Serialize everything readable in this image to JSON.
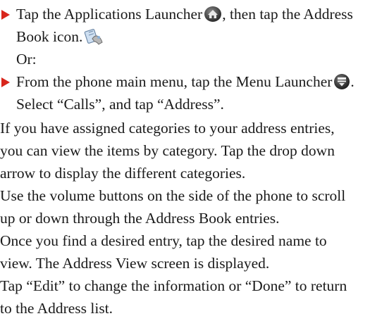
{
  "bullets": [
    {
      "lines": [
        {
          "before_icon": "Tap the Applications Launcher",
          "icon": "applications-launcher-icon",
          "after_icon": ", then tap the Address"
        },
        {
          "before_icon": "Book icon.",
          "icon": "address-book-icon",
          "after_icon": ""
        }
      ]
    },
    {
      "lines": [
        {
          "before_icon": "From the phone main menu, tap the Menu Launcher",
          "icon": "menu-launcher-icon",
          "after_icon": "."
        },
        {
          "text": "Select “Calls”, and tap “Address”."
        }
      ]
    }
  ],
  "or_label": "Or:",
  "paragraphs": [
    "If you have assigned categories to your address entries,",
    "you can view the items by category. Tap the drop down",
    "arrow to display the different categories.",
    "Use the volume buttons on the side of the phone to scroll",
    "up or down through the Address Book entries.",
    "Once you find a desired entry, tap the desired name to",
    "view. The Address View screen is displayed.",
    "Tap “Edit” to change the information or “Done” to return",
    "to the Address list."
  ],
  "colors": {
    "bullet_marker": "#d8261c",
    "text": "#1a1a1a"
  }
}
